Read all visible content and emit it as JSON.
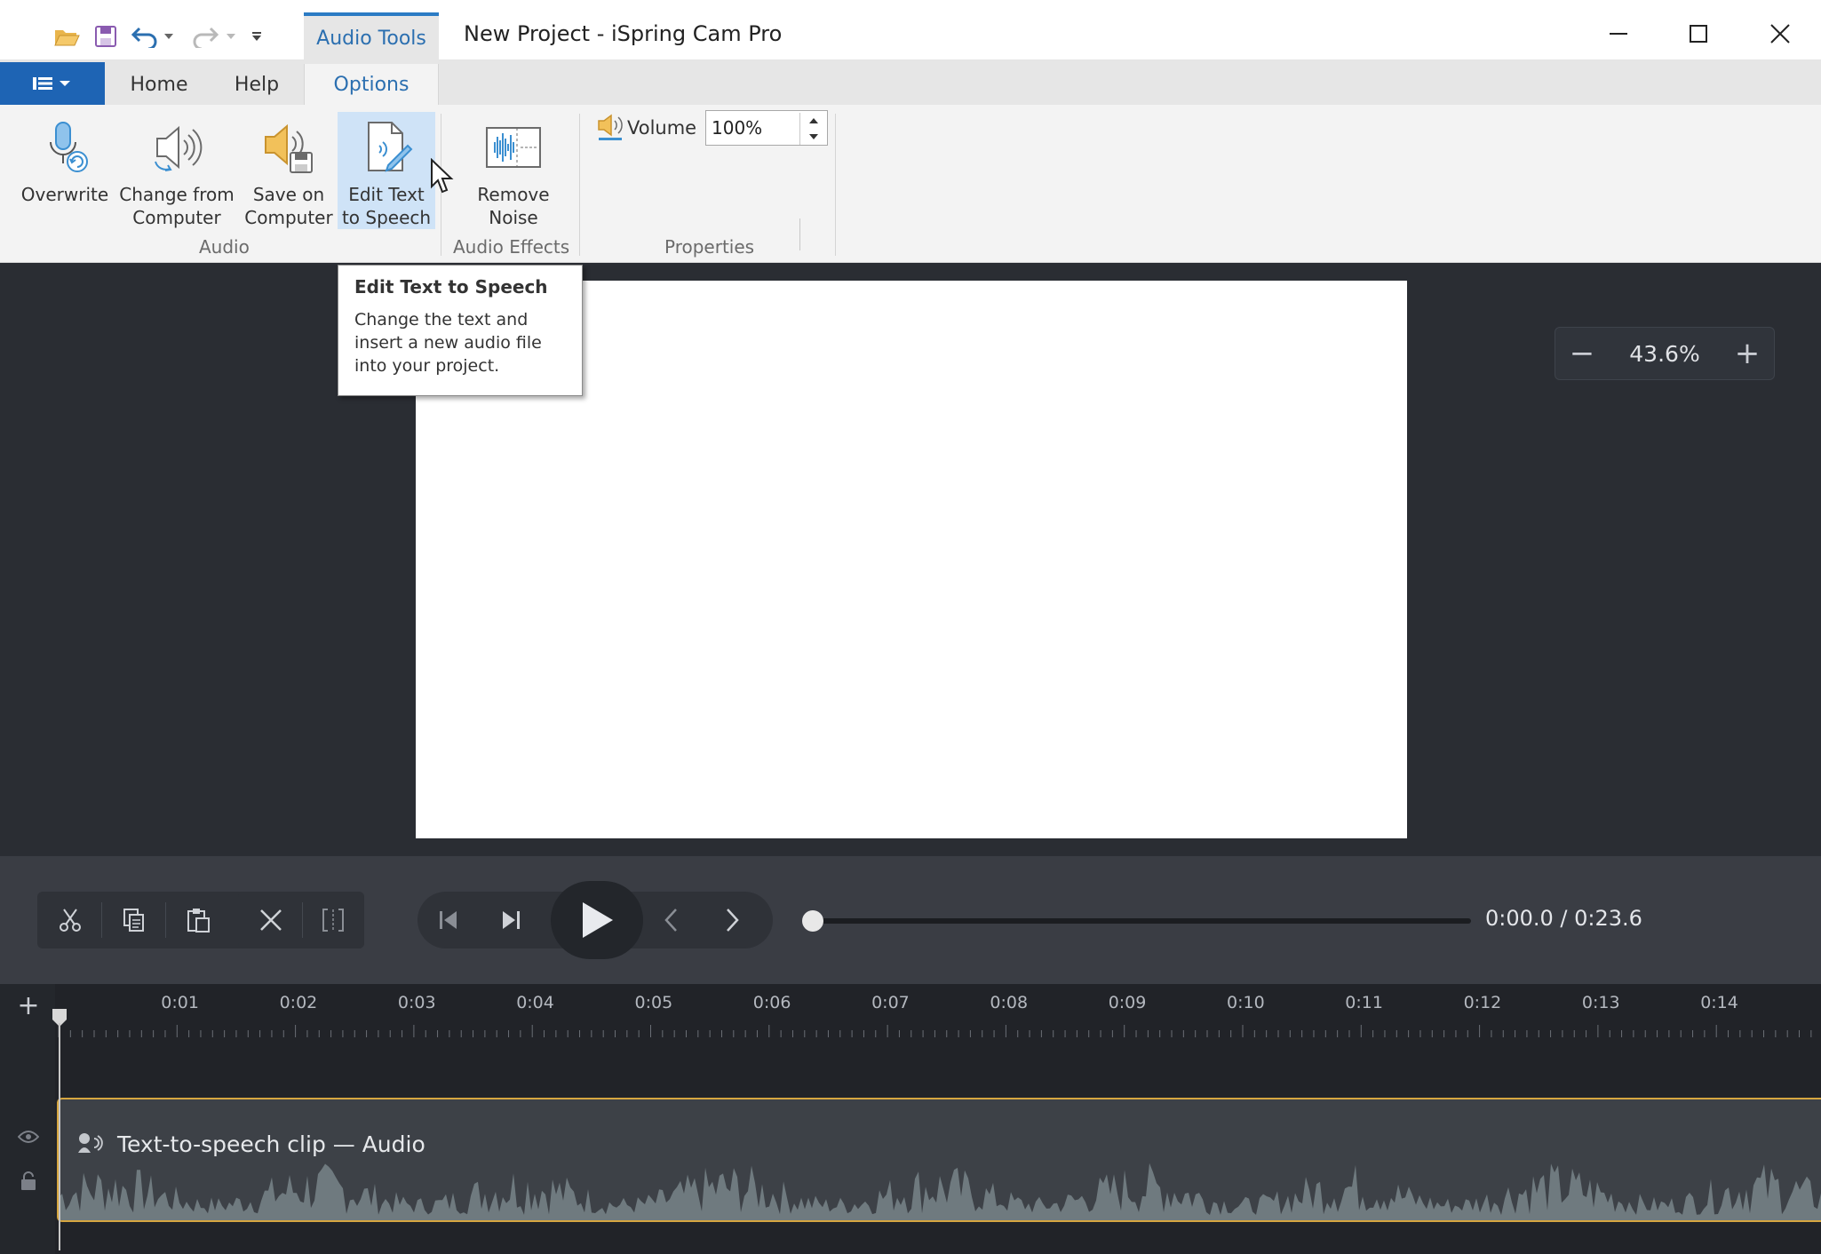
{
  "window": {
    "title": "New Project - iSpring Cam Pro",
    "context_tab": "Audio Tools"
  },
  "quick_access": [
    "open-folder-icon",
    "save-icon",
    "undo-icon",
    "redo-icon",
    "customize-icon"
  ],
  "ribbon_tabs": {
    "home": "Home",
    "help": "Help",
    "options": "Options",
    "active": "Options"
  },
  "ribbon": {
    "buttons": {
      "overwrite": "Overwrite",
      "change_from_computer": "Change from\nComputer",
      "save_on_computer": "Save on\nComputer",
      "edit_text_to_speech": "Edit Text\nto Speech",
      "remove_noise": "Remove\nNoise"
    },
    "groups": {
      "audio": "Audio",
      "audio_effects": "Audio Effects",
      "properties": "Properties"
    },
    "volume": {
      "label": "Volume",
      "value": "100%"
    }
  },
  "tooltip": {
    "title": "Edit Text to Speech",
    "description": "Change the text and insert a new audio file into your project."
  },
  "zoom": {
    "value": "43.6%",
    "minus": "−",
    "plus": "+"
  },
  "playback": {
    "time": "0:00.0 / 0:23.6",
    "progress_fraction": 0.0
  },
  "timeline": {
    "ruler": [
      "0:01",
      "0:02",
      "0:03",
      "0:04",
      "0:05",
      "0:06",
      "0:07",
      "0:08",
      "0:09",
      "0:10",
      "0:11",
      "0:12",
      "0:13",
      "0:14"
    ],
    "add": "+",
    "clip_label": "Text-to-speech clip — Audio"
  },
  "colors": {
    "accent_blue": "#1e64b4",
    "workspace_bg": "#2a2d33",
    "clip_border": "#d6a640",
    "waveform": "#6f7a7f"
  }
}
